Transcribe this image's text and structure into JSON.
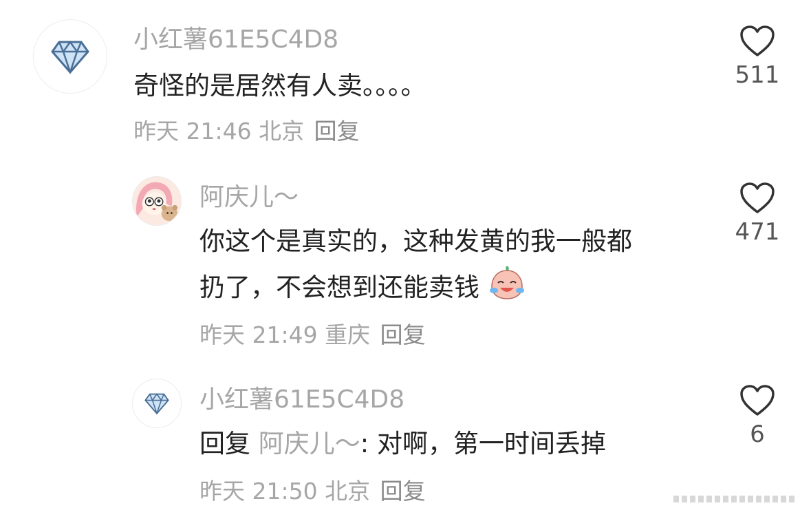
{
  "comments": [
    {
      "username": "小红薯61E5C4D8",
      "text": "奇怪的是居然有人卖。。。。",
      "time": "昨天 21:46",
      "location": "北京",
      "reply_label": "回复",
      "likes": "511",
      "avatar_icon": "diamond-icon"
    },
    {
      "username": "阿庆儿～",
      "text_line1": "你这个是真实的，这种发黄的我一般都",
      "text_line2": "扔了，不会想到还能卖钱",
      "emoji": "laughing-crying-emoji",
      "time": "昨天 21:49",
      "location": "重庆",
      "reply_label": "回复",
      "likes": "471",
      "avatar_icon": "cartoon-girl-avatar"
    },
    {
      "username": "小红薯61E5C4D8",
      "reply_prefix": "回复",
      "mention": "阿庆儿～",
      "text": ": 对啊，第一时间丢掉",
      "time": "昨天 21:50",
      "location": "北京",
      "reply_label": "回复",
      "likes": "6",
      "avatar_icon": "diamond-icon"
    }
  ],
  "colors": {
    "username": "#a6a6a6",
    "content": "#222222",
    "meta": "#a6a6a6",
    "like_icon": "#333333"
  }
}
